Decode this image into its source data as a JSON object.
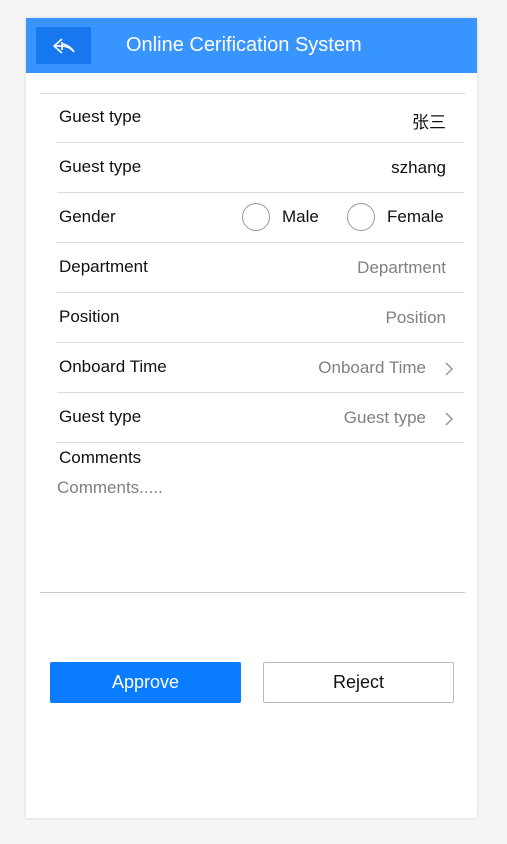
{
  "header": {
    "title": "Online Cerification System",
    "back_icon": "reply-arrow-icon"
  },
  "form": {
    "rows": [
      {
        "label": "Guest type",
        "value": "张三"
      },
      {
        "label": "Guest type",
        "value": "szhang"
      },
      {
        "label": "Gender",
        "options": [
          "Male",
          "Female"
        ],
        "selected": null
      },
      {
        "label": "Department",
        "placeholder": "Department",
        "value": ""
      },
      {
        "label": "Position",
        "placeholder": "Position",
        "value": ""
      },
      {
        "label": "Onboard Time",
        "placeholder": "Onboard Time",
        "icon": "chevron-right-icon"
      },
      {
        "label": "Guest type",
        "placeholder": "Guest type",
        "icon": "chevron-right-icon"
      }
    ],
    "comments": {
      "label": "Comments",
      "placeholder": "Comments....."
    }
  },
  "actions": {
    "approve_label": "Approve",
    "reject_label": "Reject"
  },
  "colors": {
    "header_bg": "#3894ff",
    "back_button_bg": "#1677ee",
    "approve_bg": "#0a7cff"
  }
}
